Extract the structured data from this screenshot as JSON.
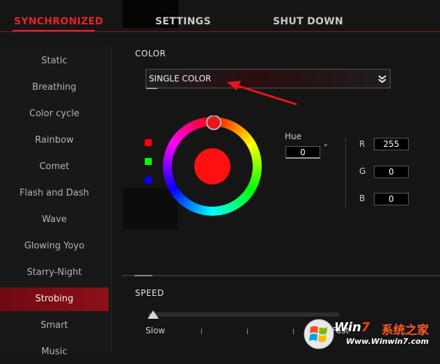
{
  "tabs": [
    {
      "label": "SYNCHRONIZED",
      "active": true
    },
    {
      "label": "SETTINGS",
      "active": false
    },
    {
      "label": "SHUT DOWN",
      "active": false
    }
  ],
  "sidebar": {
    "items": [
      {
        "label": "Static"
      },
      {
        "label": "Breathing"
      },
      {
        "label": "Color cycle"
      },
      {
        "label": "Rainbow"
      },
      {
        "label": "Comet"
      },
      {
        "label": "Flash and Dash"
      },
      {
        "label": "Wave"
      },
      {
        "label": "Glowing Yoyo"
      },
      {
        "label": "Starry-Night"
      },
      {
        "label": "Strobing",
        "active": true
      },
      {
        "label": "Smart"
      },
      {
        "label": "Music"
      }
    ]
  },
  "color_section": {
    "label": "COLOR",
    "dropdown_value": "SINGLE COLOR",
    "swatches": [
      "#ff0000",
      "#00ff00",
      "#0000ff"
    ],
    "current_color": "#ff1010",
    "hue_label": "Hue",
    "hue_value": "0",
    "hue_unit": "°",
    "r_label": "R",
    "r_value": "255",
    "g_label": "G",
    "g_value": "0",
    "b_label": "B",
    "b_value": "0"
  },
  "speed_section": {
    "label": "SPEED",
    "slow_label": "Slow",
    "fast_label": "Fast",
    "level": 0
  },
  "watermark": {
    "logo_prefix": "Win",
    "logo_seven": "7",
    "cn_text": "系统之家",
    "url": "Www.Winwin7.com"
  },
  "accent": "#e1242c"
}
